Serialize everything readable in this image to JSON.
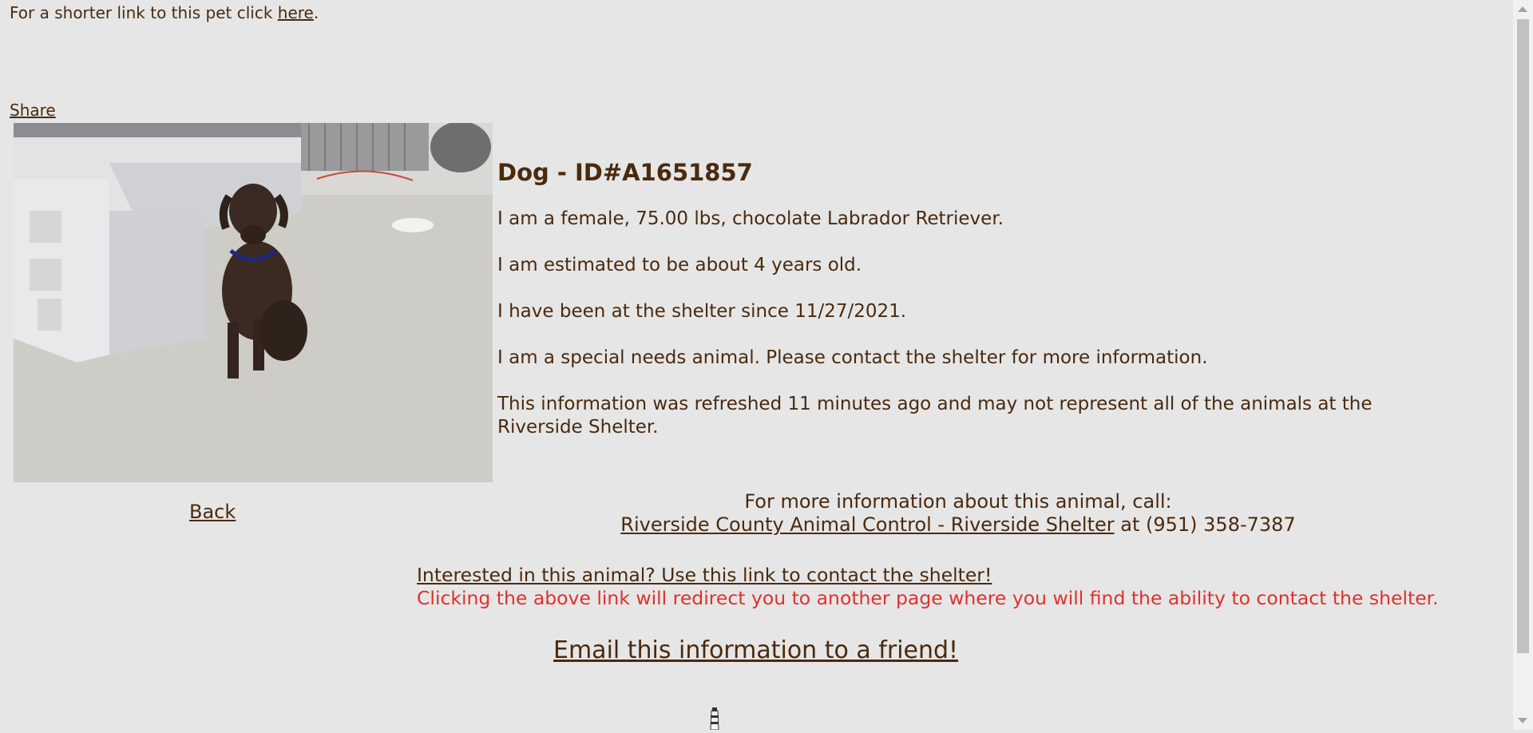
{
  "short_link": {
    "prefix": "For a shorter link to this pet click ",
    "link_text": "here",
    "suffix": "."
  },
  "share_label": "Share",
  "pet": {
    "title": "Dog - ID#A1651857",
    "description": "I am a female, 75.00 lbs, chocolate Labrador Retriever.",
    "age": "I am estimated to be about 4 years old.",
    "since": "I have been at the shelter since 11/27/2021.",
    "special_needs": "I am a special needs animal. Please contact the shelter for more information.",
    "refresh_note": "This information was refreshed 11 minutes ago and may not represent all of the animals at the Riverside Shelter."
  },
  "back_label": "Back",
  "call": {
    "heading": "For more information about this animal, call:",
    "shelter_link": "Riverside County Animal Control - Riverside Shelter",
    "phone_text": " at (951) 358-7387"
  },
  "contact": {
    "link": "Interested in this animal? Use this link to contact the shelter!",
    "note": "Clicking the above link will redirect you to another page where you will find the ability to contact the shelter."
  },
  "email_link": "Email this information to a friend!",
  "colors": {
    "text": "#4a2a0e",
    "warning": "#e0312b",
    "background": "#e6e6e6"
  },
  "icons": {
    "photo": "dog-photo",
    "bottom": "lighthouse-icon"
  }
}
